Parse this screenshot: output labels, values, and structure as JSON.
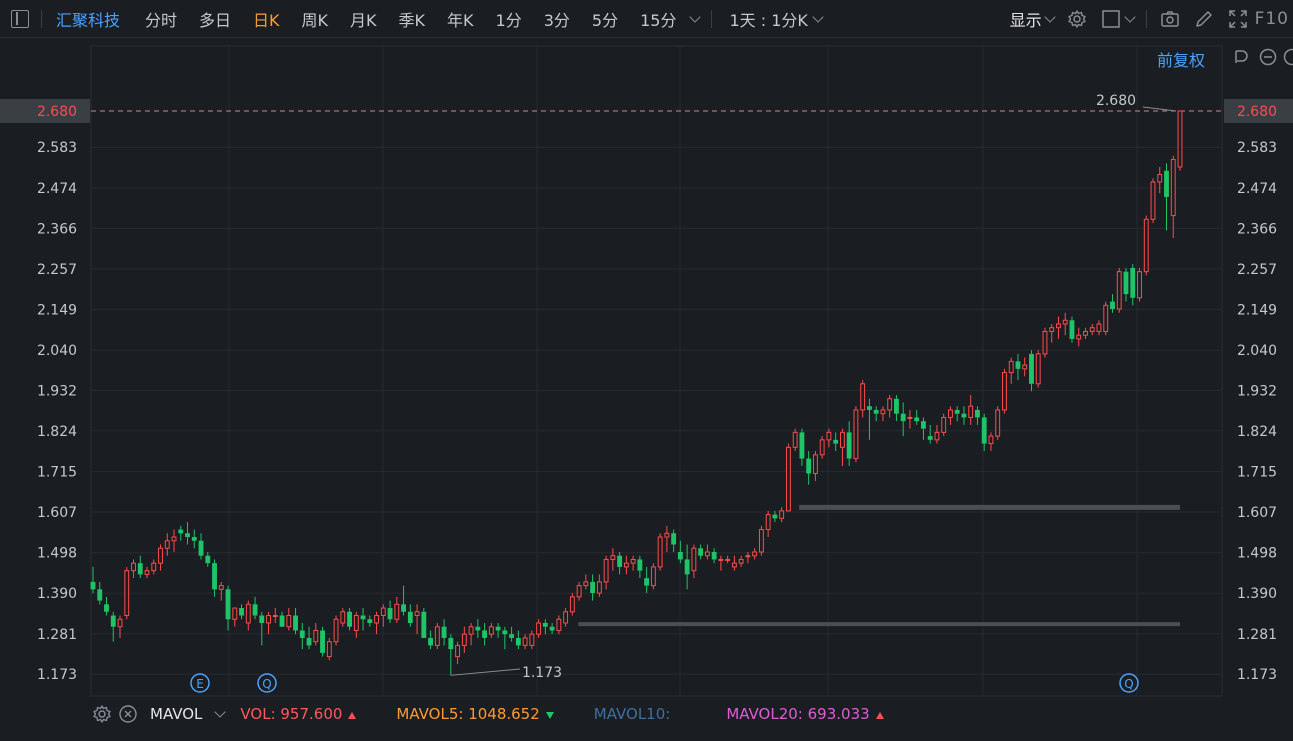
{
  "header": {
    "stock_name": "汇聚科技",
    "tabs": [
      "分时",
      "多日",
      "日K",
      "周K",
      "月K",
      "季K",
      "年K",
      "1分",
      "3分",
      "5分",
      "15分"
    ],
    "active_tab": "日K",
    "combo_label": "1天 : 1分K",
    "display_label": "显示",
    "f10_label": "F10"
  },
  "adjust_label": "前复权",
  "colors": {
    "up": "#ff4b4b",
    "down": "#1ec468",
    "accent": "#4aa3ff",
    "active_tab": "#ff9b2f",
    "vol": "#ff5a5a",
    "mavol5": "#ff9b2f",
    "mavol10": "#3f6fa0",
    "mavol20": "#e05cd6"
  },
  "chart_data": {
    "type": "candlestick",
    "ylim": [
      1.12,
      2.72
    ],
    "y_ticks": [
      "2.680",
      "2.583",
      "2.474",
      "2.366",
      "2.257",
      "2.149",
      "2.040",
      "1.932",
      "1.824",
      "1.715",
      "1.607",
      "1.498",
      "1.390",
      "1.281",
      "1.173"
    ],
    "current_price_label": "2.680",
    "high_annotation": "2.680",
    "low_annotation": "1.173",
    "support_levels": [
      1.307,
      1.618
    ],
    "event_markers": [
      "E",
      "Q",
      "Q"
    ],
    "grid": true,
    "candles": [
      [
        1.42,
        1.46,
        1.39,
        1.4
      ],
      [
        1.4,
        1.42,
        1.36,
        1.37
      ],
      [
        1.36,
        1.38,
        1.33,
        1.34
      ],
      [
        1.33,
        1.34,
        1.26,
        1.3
      ],
      [
        1.3,
        1.33,
        1.27,
        1.32
      ],
      [
        1.33,
        1.46,
        1.32,
        1.45
      ],
      [
        1.45,
        1.48,
        1.43,
        1.47
      ],
      [
        1.47,
        1.49,
        1.43,
        1.44
      ],
      [
        1.44,
        1.46,
        1.43,
        1.45
      ],
      [
        1.45,
        1.48,
        1.44,
        1.47
      ],
      [
        1.47,
        1.52,
        1.45,
        1.51
      ],
      [
        1.51,
        1.55,
        1.49,
        1.53
      ],
      [
        1.53,
        1.56,
        1.5,
        1.54
      ],
      [
        1.56,
        1.57,
        1.53,
        1.55
      ],
      [
        1.55,
        1.58,
        1.52,
        1.54
      ],
      [
        1.54,
        1.56,
        1.51,
        1.53
      ],
      [
        1.53,
        1.55,
        1.48,
        1.49
      ],
      [
        1.49,
        1.5,
        1.46,
        1.47
      ],
      [
        1.47,
        1.48,
        1.38,
        1.4
      ],
      [
        1.4,
        1.42,
        1.37,
        1.41
      ],
      [
        1.4,
        1.41,
        1.29,
        1.32
      ],
      [
        1.32,
        1.35,
        1.3,
        1.35
      ],
      [
        1.35,
        1.36,
        1.32,
        1.33
      ],
      [
        1.31,
        1.37,
        1.29,
        1.36
      ],
      [
        1.36,
        1.38,
        1.32,
        1.33
      ],
      [
        1.33,
        1.34,
        1.25,
        1.31
      ],
      [
        1.31,
        1.34,
        1.28,
        1.33
      ],
      [
        1.33,
        1.35,
        1.31,
        1.33
      ],
      [
        1.33,
        1.34,
        1.3,
        1.3
      ],
      [
        1.3,
        1.35,
        1.29,
        1.33
      ],
      [
        1.33,
        1.35,
        1.28,
        1.29
      ],
      [
        1.29,
        1.31,
        1.24,
        1.27
      ],
      [
        1.27,
        1.3,
        1.24,
        1.25
      ],
      [
        1.26,
        1.31,
        1.25,
        1.29
      ],
      [
        1.29,
        1.3,
        1.22,
        1.23
      ],
      [
        1.22,
        1.27,
        1.21,
        1.26
      ],
      [
        1.26,
        1.33,
        1.25,
        1.32
      ],
      [
        1.31,
        1.35,
        1.3,
        1.34
      ],
      [
        1.34,
        1.35,
        1.29,
        1.3
      ],
      [
        1.29,
        1.34,
        1.27,
        1.33
      ],
      [
        1.33,
        1.35,
        1.29,
        1.32
      ],
      [
        1.32,
        1.33,
        1.3,
        1.31
      ],
      [
        1.31,
        1.34,
        1.28,
        1.33
      ],
      [
        1.33,
        1.36,
        1.3,
        1.35
      ],
      [
        1.35,
        1.37,
        1.31,
        1.32
      ],
      [
        1.32,
        1.38,
        1.31,
        1.36
      ],
      [
        1.36,
        1.41,
        1.33,
        1.34
      ],
      [
        1.34,
        1.36,
        1.3,
        1.31
      ],
      [
        1.33,
        1.36,
        1.28,
        1.34
      ],
      [
        1.34,
        1.35,
        1.27,
        1.27
      ],
      [
        1.27,
        1.29,
        1.24,
        1.25
      ],
      [
        1.25,
        1.31,
        1.24,
        1.3
      ],
      [
        1.3,
        1.32,
        1.25,
        1.27
      ],
      [
        1.27,
        1.28,
        1.17,
        1.24
      ],
      [
        1.22,
        1.26,
        1.2,
        1.25
      ],
      [
        1.25,
        1.3,
        1.23,
        1.28
      ],
      [
        1.28,
        1.31,
        1.25,
        1.3
      ],
      [
        1.3,
        1.32,
        1.27,
        1.29
      ],
      [
        1.29,
        1.31,
        1.25,
        1.27
      ],
      [
        1.28,
        1.31,
        1.27,
        1.3
      ],
      [
        1.3,
        1.31,
        1.27,
        1.29
      ],
      [
        1.29,
        1.3,
        1.24,
        1.28
      ],
      [
        1.28,
        1.3,
        1.26,
        1.27
      ],
      [
        1.27,
        1.29,
        1.24,
        1.25
      ],
      [
        1.25,
        1.28,
        1.24,
        1.27
      ],
      [
        1.25,
        1.29,
        1.24,
        1.28
      ],
      [
        1.28,
        1.32,
        1.27,
        1.31
      ],
      [
        1.31,
        1.32,
        1.28,
        1.3
      ],
      [
        1.3,
        1.31,
        1.28,
        1.29
      ],
      [
        1.29,
        1.33,
        1.28,
        1.32
      ],
      [
        1.31,
        1.35,
        1.3,
        1.34
      ],
      [
        1.34,
        1.39,
        1.33,
        1.38
      ],
      [
        1.38,
        1.42,
        1.37,
        1.41
      ],
      [
        1.41,
        1.44,
        1.4,
        1.42
      ],
      [
        1.42,
        1.44,
        1.37,
        1.39
      ],
      [
        1.39,
        1.44,
        1.38,
        1.42
      ],
      [
        1.42,
        1.49,
        1.4,
        1.48
      ],
      [
        1.48,
        1.51,
        1.45,
        1.49
      ],
      [
        1.49,
        1.5,
        1.44,
        1.46
      ],
      [
        1.46,
        1.49,
        1.44,
        1.47
      ],
      [
        1.47,
        1.49,
        1.45,
        1.48
      ],
      [
        1.48,
        1.49,
        1.43,
        1.45
      ],
      [
        1.43,
        1.46,
        1.39,
        1.41
      ],
      [
        1.41,
        1.47,
        1.4,
        1.46
      ],
      [
        1.46,
        1.55,
        1.45,
        1.54
      ],
      [
        1.54,
        1.57,
        1.5,
        1.55
      ],
      [
        1.55,
        1.56,
        1.5,
        1.52
      ],
      [
        1.5,
        1.53,
        1.47,
        1.48
      ],
      [
        1.48,
        1.52,
        1.4,
        1.44
      ],
      [
        1.45,
        1.52,
        1.43,
        1.51
      ],
      [
        1.51,
        1.52,
        1.48,
        1.49
      ],
      [
        1.49,
        1.52,
        1.48,
        1.5
      ],
      [
        1.5,
        1.51,
        1.47,
        1.48
      ],
      [
        1.48,
        1.49,
        1.45,
        1.48
      ],
      [
        1.48,
        1.49,
        1.47,
        1.48
      ],
      [
        1.46,
        1.49,
        1.45,
        1.47
      ],
      [
        1.47,
        1.49,
        1.46,
        1.48
      ],
      [
        1.49,
        1.5,
        1.47,
        1.49
      ],
      [
        1.49,
        1.51,
        1.48,
        1.5
      ],
      [
        1.5,
        1.57,
        1.49,
        1.56
      ],
      [
        1.56,
        1.61,
        1.54,
        1.6
      ],
      [
        1.6,
        1.61,
        1.58,
        1.59
      ],
      [
        1.59,
        1.62,
        1.58,
        1.61
      ],
      [
        1.61,
        1.79,
        1.61,
        1.78
      ],
      [
        1.78,
        1.83,
        1.77,
        1.82
      ],
      [
        1.82,
        1.83,
        1.73,
        1.75
      ],
      [
        1.75,
        1.77,
        1.68,
        1.71
      ],
      [
        1.71,
        1.77,
        1.69,
        1.76
      ],
      [
        1.76,
        1.81,
        1.75,
        1.8
      ],
      [
        1.8,
        1.83,
        1.78,
        1.82
      ],
      [
        1.8,
        1.82,
        1.77,
        1.79
      ],
      [
        1.78,
        1.83,
        1.73,
        1.82
      ],
      [
        1.82,
        1.85,
        1.73,
        1.75
      ],
      [
        1.75,
        1.89,
        1.74,
        1.88
      ],
      [
        1.88,
        1.96,
        1.86,
        1.95
      ],
      [
        1.89,
        1.91,
        1.8,
        1.88
      ],
      [
        1.88,
        1.89,
        1.85,
        1.87
      ],
      [
        1.87,
        1.89,
        1.85,
        1.88
      ],
      [
        1.88,
        1.92,
        1.86,
        1.91
      ],
      [
        1.91,
        1.92,
        1.85,
        1.87
      ],
      [
        1.87,
        1.9,
        1.81,
        1.85
      ],
      [
        1.86,
        1.88,
        1.83,
        1.86
      ],
      [
        1.86,
        1.88,
        1.84,
        1.85
      ],
      [
        1.85,
        1.86,
        1.8,
        1.83
      ],
      [
        1.81,
        1.84,
        1.79,
        1.8
      ],
      [
        1.8,
        1.84,
        1.79,
        1.82
      ],
      [
        1.82,
        1.87,
        1.81,
        1.86
      ],
      [
        1.86,
        1.89,
        1.84,
        1.88
      ],
      [
        1.88,
        1.89,
        1.85,
        1.87
      ],
      [
        1.87,
        1.89,
        1.84,
        1.86
      ],
      [
        1.86,
        1.92,
        1.84,
        1.89
      ],
      [
        1.88,
        1.89,
        1.84,
        1.86
      ],
      [
        1.86,
        1.87,
        1.77,
        1.79
      ],
      [
        1.79,
        1.82,
        1.77,
        1.81
      ],
      [
        1.81,
        1.89,
        1.8,
        1.88
      ],
      [
        1.88,
        1.99,
        1.87,
        1.98
      ],
      [
        1.98,
        2.02,
        1.95,
        2.01
      ],
      [
        2.01,
        2.03,
        1.96,
        1.99
      ],
      [
        1.99,
        2.02,
        1.97,
        2.0
      ],
      [
        2.03,
        2.04,
        1.93,
        1.95
      ],
      [
        1.95,
        2.04,
        1.94,
        2.03
      ],
      [
        2.03,
        2.1,
        2.02,
        2.09
      ],
      [
        2.09,
        2.11,
        2.06,
        2.1
      ],
      [
        2.1,
        2.13,
        2.07,
        2.11
      ],
      [
        2.11,
        2.14,
        2.08,
        2.12
      ],
      [
        2.12,
        2.13,
        2.06,
        2.07
      ],
      [
        2.07,
        2.1,
        2.05,
        2.08
      ],
      [
        2.08,
        2.1,
        2.07,
        2.09
      ],
      [
        2.09,
        2.11,
        2.08,
        2.1
      ],
      [
        2.09,
        2.12,
        2.08,
        2.11
      ],
      [
        2.09,
        2.17,
        2.08,
        2.16
      ],
      [
        2.17,
        2.19,
        2.14,
        2.15
      ],
      [
        2.15,
        2.26,
        2.14,
        2.25
      ],
      [
        2.25,
        2.26,
        2.17,
        2.19
      ],
      [
        2.26,
        2.27,
        2.16,
        2.18
      ],
      [
        2.18,
        2.26,
        2.17,
        2.25
      ],
      [
        2.25,
        2.4,
        2.24,
        2.39
      ],
      [
        2.39,
        2.5,
        2.38,
        2.49
      ],
      [
        2.49,
        2.53,
        2.46,
        2.51
      ],
      [
        2.52,
        2.54,
        2.36,
        2.45
      ],
      [
        2.4,
        2.56,
        2.34,
        2.55
      ],
      [
        2.53,
        2.68,
        2.52,
        2.68
      ]
    ]
  },
  "volume_indicator": {
    "name": "MAVOL",
    "vol": "VOL: 957.600",
    "mavol5": "MAVOL5: 1048.652",
    "mavol10": "MAVOL10:",
    "mavol20": "MAVOL20: 693.033"
  }
}
